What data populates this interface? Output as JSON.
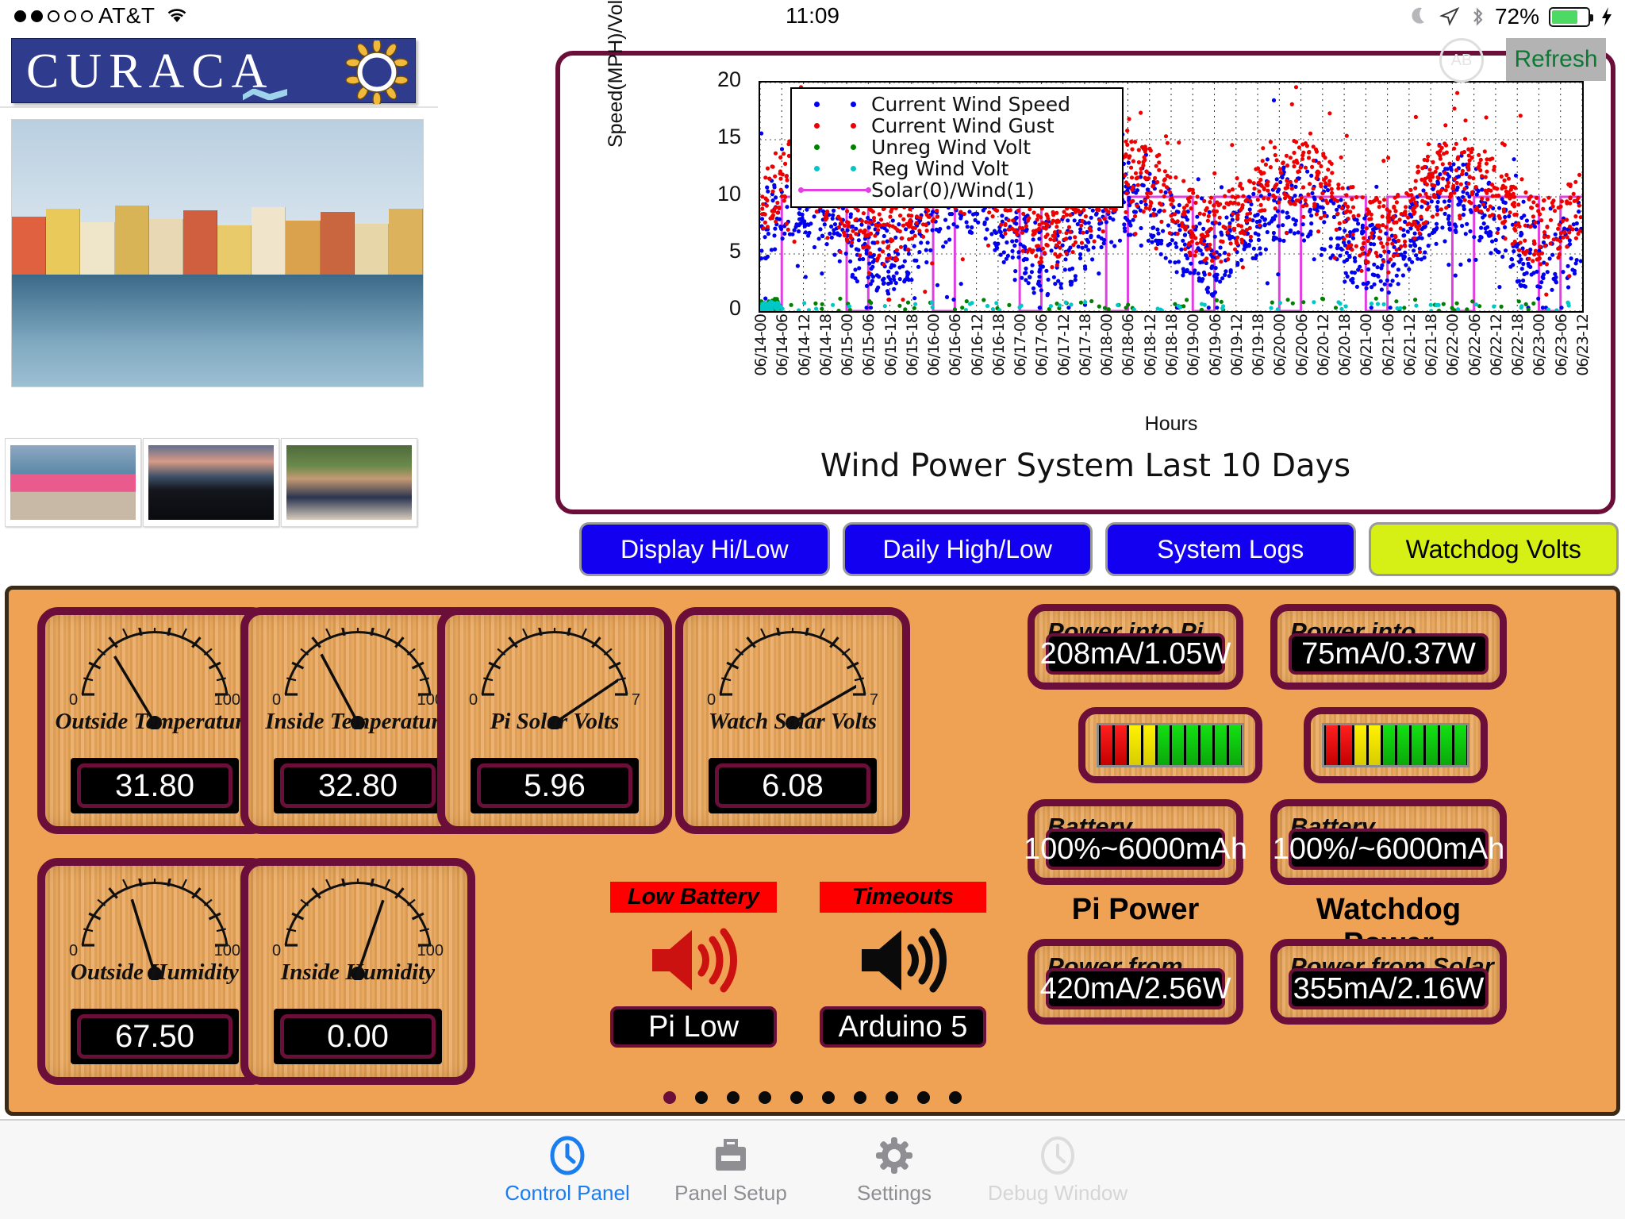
{
  "status_bar": {
    "signal_dots_filled": 2,
    "signal_dots_total": 5,
    "carrier": "AT&T",
    "wifi_icon": "wifi-icon",
    "time": "11:09",
    "moon_icon": "moon-icon",
    "location_icon": "location-arrow-icon",
    "bluetooth_icon": "bluetooth-icon",
    "battery_percent": "72%",
    "battery_icon": "battery-icon",
    "charging_icon": "lightning-bolt-icon"
  },
  "logo": {
    "text": "CURACAO",
    "letters": [
      "C",
      "U",
      "R",
      "A",
      "C",
      "A",
      "O"
    ],
    "accent_yellow": "#f2e712",
    "accent_red": "#e01a1a",
    "banner_color": "#2f3b8c",
    "sun_color": "#f0b93c"
  },
  "photos": {
    "main_caption": "",
    "thumbnails": [
      "thumbnail-1",
      "thumbnail-2",
      "thumbnail-3"
    ]
  },
  "chart_panel": {
    "refresh_label": "Refresh",
    "refresh_text_color": "#0b7a33",
    "refresh_bg_color": "#b3b3b3",
    "ghost_label": "AB",
    "border_color": "#6b0f3a"
  },
  "chart_data": {
    "type": "scatter",
    "title": "Wind Power System Last 10 Days",
    "xlabel": "Hours",
    "ylabel": "Speed(MPH)/Voltage(V)",
    "ylim": [
      0,
      20
    ],
    "yticks": [
      0,
      5,
      10,
      15,
      20
    ],
    "grid": true,
    "legend_position": "top-left",
    "xticks": [
      "06/14-00",
      "06/14-06",
      "06/14-12",
      "06/14-18",
      "06/15-00",
      "06/15-06",
      "06/15-12",
      "06/15-18",
      "06/16-00",
      "06/16-06",
      "06/16-12",
      "06/16-18",
      "06/17-00",
      "06/17-06",
      "06/17-12",
      "06/17-18",
      "06/18-00",
      "06/18-06",
      "06/18-12",
      "06/18-18",
      "06/19-00",
      "06/19-06",
      "06/19-12",
      "06/19-18",
      "06/20-00",
      "06/20-06",
      "06/20-12",
      "06/20-18",
      "06/21-00",
      "06/21-06",
      "06/21-12",
      "06/21-18",
      "06/22-00",
      "06/22-06",
      "06/22-12",
      "06/22-18",
      "06/23-00",
      "06/23-06",
      "06/23-12"
    ],
    "series": [
      {
        "name": "Current Wind Speed",
        "color": "#0000ee",
        "marker": "dot",
        "mean": 7.2,
        "min": 0.3,
        "max": 19.2
      },
      {
        "name": "Current Wind Gust",
        "color": "#ee0000",
        "marker": "dot",
        "mean": 9.6,
        "min": 1.0,
        "max": 19.6
      },
      {
        "name": "Unreg Wind Volt",
        "color": "#008000",
        "marker": "dot",
        "mean": 0.4,
        "min": 0.0,
        "max": 1.2
      },
      {
        "name": "Reg Wind Volt",
        "color": "#00c8c8",
        "marker": "dot",
        "mean": 0.3,
        "min": 0.0,
        "max": 0.9
      },
      {
        "name": "Solar(0)/Wind(1)",
        "color": "#e040e0",
        "marker": "line",
        "mean": 10.0,
        "min": 0.0,
        "max": 10.0
      }
    ]
  },
  "buttons": [
    {
      "label": "Display Hi/Low",
      "bg": "#1400f0",
      "fg": "#ffffff"
    },
    {
      "label": "Daily High/Low",
      "bg": "#1400f0",
      "fg": "#ffffff"
    },
    {
      "label": "System Logs",
      "bg": "#1400f0",
      "fg": "#ffffff"
    },
    {
      "label": "Watchdog Volts",
      "bg": "#d6f016",
      "fg": "#000000"
    }
  ],
  "gauges": [
    {
      "name": "Outside Temperature",
      "value": "31.80",
      "min": "0",
      "max": "100",
      "angle": -31
    },
    {
      "name": "Inside Temperature",
      "value": "32.80",
      "min": "0",
      "max": "100",
      "angle": -28
    },
    {
      "name": "Pi Solar Volts",
      "value": "5.96",
      "min": "0",
      "max": "7",
      "angle": 56
    },
    {
      "name": "Watch Solar Volts",
      "value": "6.08",
      "min": "0",
      "max": "7",
      "angle": 60
    },
    {
      "name": "Outside Humidity",
      "value": "67.50",
      "min": "0",
      "max": "100",
      "angle": -17
    },
    {
      "name": "Inside Humidity",
      "value": "0.00",
      "min": "0",
      "max": "100",
      "angle": 19
    }
  ],
  "alerts": [
    {
      "title": "Low Battery",
      "icon": "speaker-icon",
      "icon_color": "#cc1111",
      "value": "Pi Low"
    },
    {
      "title": "Timeouts",
      "icon": "speaker-icon",
      "icon_color": "#0a0a0a",
      "value": "Arduino 5"
    }
  ],
  "power": {
    "pi": {
      "into_label": "Power into Pi",
      "into_value": "208mA/1.05W",
      "battery_label": "Battery Remaining",
      "battery_value": "100%~6000mAh",
      "group_label": "Pi Power",
      "solar_label": "Power from Solar",
      "solar_value": "420mA/2.56W",
      "bar_segments": [
        "red",
        "red",
        "yellow",
        "yellow",
        "green",
        "green",
        "green",
        "green",
        "green",
        "green"
      ]
    },
    "watchdog": {
      "into_label": "Power into Arduino",
      "into_value": "75mA/0.37W",
      "battery_label": "Battery Remaining",
      "battery_value": "100%/~6000mAh",
      "group_label": "Watchdog Power",
      "solar_label": "Power from Solar",
      "solar_value": "355mA/2.16W",
      "bar_segments": [
        "red",
        "red",
        "yellow",
        "yellow",
        "green",
        "green",
        "green",
        "green",
        "green",
        "green"
      ]
    }
  },
  "page_dots": {
    "total": 10,
    "active_index": 0,
    "active_color": "#6b0f3a"
  },
  "tabs": [
    {
      "label": "Control Panel",
      "icon": "clock-icon",
      "state": "active"
    },
    {
      "label": "Panel Setup",
      "icon": "briefcase-icon",
      "state": "normal"
    },
    {
      "label": "Settings",
      "icon": "gear-icon",
      "state": "normal"
    },
    {
      "label": "Debug Window",
      "icon": "clock-icon",
      "state": "disabled"
    }
  ]
}
